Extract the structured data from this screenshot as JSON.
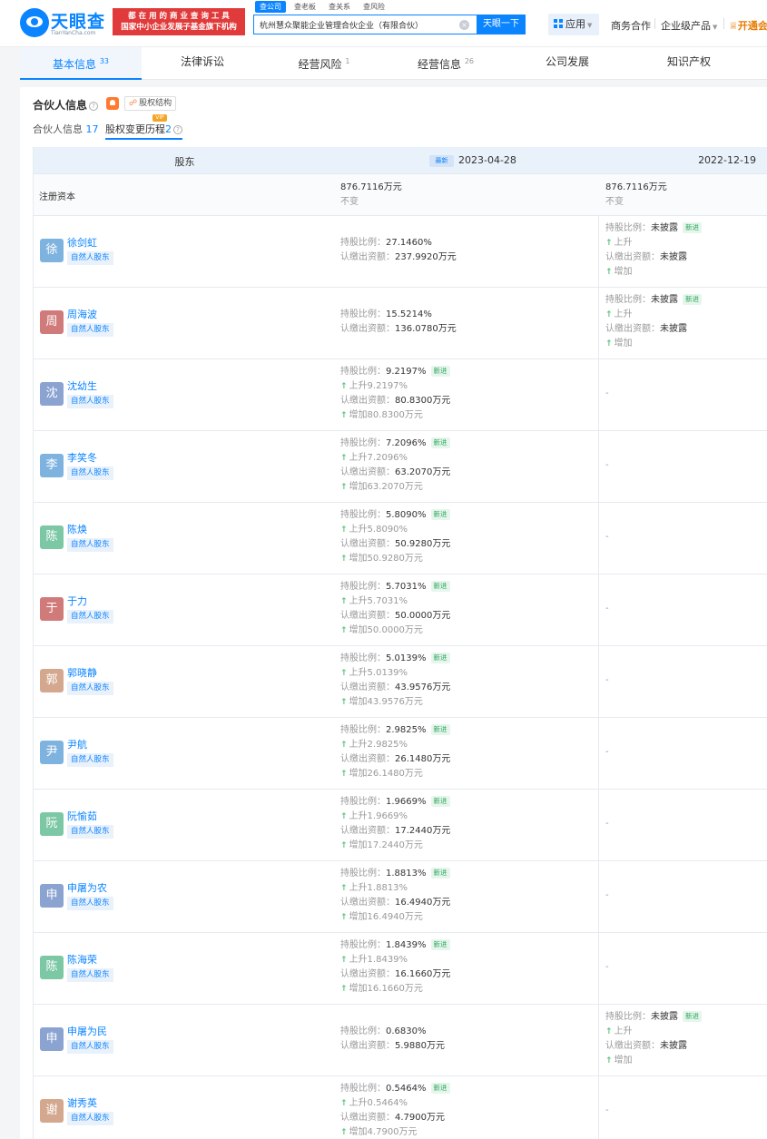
{
  "header": {
    "logo_text": "天眼查",
    "logo_sub": "TianYanCha.com",
    "slogan_line1": "都 在 用 的 商 业 查 询 工 具",
    "slogan_line2": "国家中小企业发展子基金旗下机构",
    "search_tabs": [
      "查公司",
      "查老板",
      "查关系",
      "查风险"
    ],
    "search_value": "杭州慧众聚能企业管理合伙企业（有限合伙）",
    "search_button": "天眼一下",
    "apps_label": "应用",
    "nav_business": "商务合作",
    "nav_enterprise": "企业级产品",
    "nav_vip": "开通会"
  },
  "tabs": [
    {
      "label": "基本信息",
      "count": "33"
    },
    {
      "label": "法律诉讼",
      "count": ""
    },
    {
      "label": "经营风险",
      "count": "1"
    },
    {
      "label": "经营信息",
      "count": "26"
    },
    {
      "label": "公司发展",
      "count": ""
    },
    {
      "label": "知识产权",
      "count": ""
    }
  ],
  "section": {
    "title": "合伙人信息",
    "equity_button": "股权结构",
    "sub_tab1_label": "合伙人信息",
    "sub_tab1_count": "17",
    "sub_tab2_label": "股权变更历程",
    "sub_tab2_count": "2",
    "vip_tag": "VIP"
  },
  "table": {
    "col_shareholder": "股东",
    "latest_badge": "最新",
    "date_new": "2023-04-28",
    "date_old": "2022-12-19",
    "capital_label": "注册资本",
    "capital_new": "876.7116万元",
    "capital_new_status": "不变",
    "capital_old": "876.7116万元",
    "capital_old_status": "不变",
    "ratio_label": "持股比例：",
    "amount_label": "认缴出资额：",
    "new_tag": "新进",
    "rise_prefix": "上升",
    "add_prefix": "增加",
    "role": "自然人股东",
    "undisclosed": "未披露",
    "dash": "-"
  },
  "rows": [
    {
      "avatar": "徐",
      "color": "#7eb3e0",
      "name": "徐剑虹",
      "ratio": "27.1460%",
      "amount": "237.9920万元",
      "is_new": false,
      "ratio_change": "",
      "amount_change": "",
      "old": "undisclosed"
    },
    {
      "avatar": "周",
      "color": "#d07a7a",
      "name": "周海波",
      "ratio": "15.5214%",
      "amount": "136.0780万元",
      "is_new": false,
      "ratio_change": "",
      "amount_change": "",
      "old": "undisclosed"
    },
    {
      "avatar": "沈",
      "color": "#8aa3d0",
      "name": "沈幼生",
      "ratio": "9.2197%",
      "amount": "80.8300万元",
      "is_new": true,
      "ratio_change": "9.2197%",
      "amount_change": "80.8300万元",
      "old": "dash"
    },
    {
      "avatar": "李",
      "color": "#7eb3e0",
      "name": "李笑冬",
      "ratio": "7.2096%",
      "amount": "63.2070万元",
      "is_new": true,
      "ratio_change": "7.2096%",
      "amount_change": "63.2070万元",
      "old": "dash"
    },
    {
      "avatar": "陈",
      "color": "#7cc8a4",
      "name": "陈焕",
      "ratio": "5.8090%",
      "amount": "50.9280万元",
      "is_new": true,
      "ratio_change": "5.8090%",
      "amount_change": "50.9280万元",
      "old": "dash"
    },
    {
      "avatar": "于",
      "color": "#d07a7a",
      "name": "于力",
      "ratio": "5.7031%",
      "amount": "50.0000万元",
      "is_new": true,
      "ratio_change": "5.7031%",
      "amount_change": "50.0000万元",
      "old": "dash"
    },
    {
      "avatar": "郭",
      "color": "#d3a88f",
      "name": "郭晓静",
      "ratio": "5.0139%",
      "amount": "43.9576万元",
      "is_new": true,
      "ratio_change": "5.0139%",
      "amount_change": "43.9576万元",
      "old": "dash"
    },
    {
      "avatar": "尹",
      "color": "#7eb3e0",
      "name": "尹航",
      "ratio": "2.9825%",
      "amount": "26.1480万元",
      "is_new": true,
      "ratio_change": "2.9825%",
      "amount_change": "26.1480万元",
      "old": "dash"
    },
    {
      "avatar": "阮",
      "color": "#7cc8a4",
      "name": "阮愉茹",
      "ratio": "1.9669%",
      "amount": "17.2440万元",
      "is_new": true,
      "ratio_change": "1.9669%",
      "amount_change": "17.2440万元",
      "old": "dash"
    },
    {
      "avatar": "申",
      "color": "#8aa3d0",
      "name": "申屠为农",
      "ratio": "1.8813%",
      "amount": "16.4940万元",
      "is_new": true,
      "ratio_change": "1.8813%",
      "amount_change": "16.4940万元",
      "old": "dash"
    },
    {
      "avatar": "陈",
      "color": "#7cc8a4",
      "name": "陈海荣",
      "ratio": "1.8439%",
      "amount": "16.1660万元",
      "is_new": true,
      "ratio_change": "1.8439%",
      "amount_change": "16.1660万元",
      "old": "dash"
    },
    {
      "avatar": "申",
      "color": "#8aa3d0",
      "name": "申屠为民",
      "ratio": "0.6830%",
      "amount": "5.9880万元",
      "is_new": false,
      "ratio_change": "",
      "amount_change": "",
      "old": "undisclosed"
    },
    {
      "avatar": "谢",
      "color": "#d3a88f",
      "name": "谢秀英",
      "ratio": "0.5464%",
      "amount": "4.7900万元",
      "is_new": true,
      "ratio_change": "0.5464%",
      "amount_change": "4.7900万元",
      "old": "dash"
    }
  ]
}
